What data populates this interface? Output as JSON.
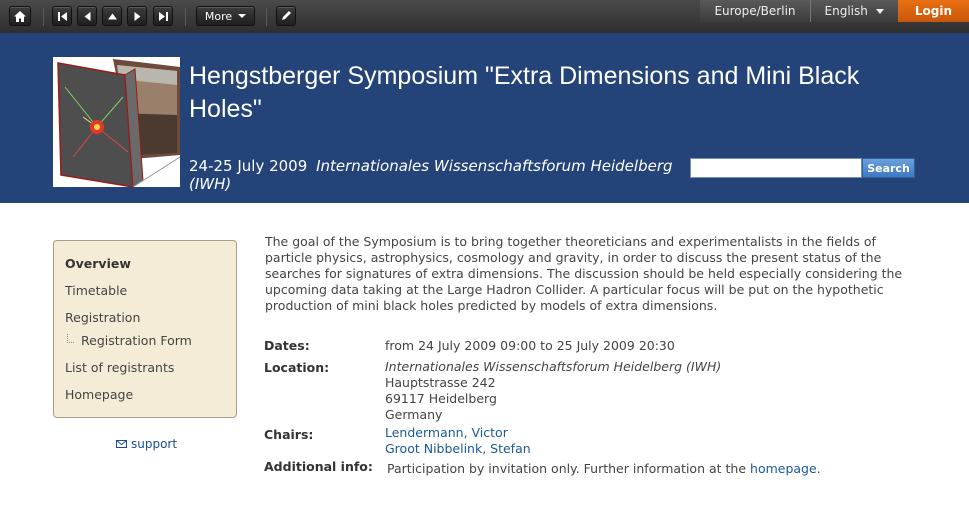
{
  "toolbar": {
    "more_label": "More",
    "icons": [
      "home-icon",
      "first-icon",
      "previous-icon",
      "up-icon",
      "next-icon",
      "last-icon",
      "edit-icon"
    ]
  },
  "topright": {
    "timezone": "Europe/Berlin",
    "language": "English",
    "login": "Login"
  },
  "header": {
    "title": "Hengstberger Symposium \"Extra Dimensions and Mini Black Holes\"",
    "dates": "24-25 July 2009",
    "venue": "Internationales Wissenschaftsforum Heidelberg (IWH)",
    "search_button": "Search",
    "search_value": ""
  },
  "sidebar": {
    "items": [
      {
        "label": "Overview"
      },
      {
        "label": "Timetable"
      },
      {
        "label": "Registration"
      },
      {
        "label": "Registration Form"
      },
      {
        "label": "List of registrants"
      },
      {
        "label": "Homepage"
      }
    ],
    "support": "support"
  },
  "main": {
    "description": "The goal of the Symposium is to bring together theoreticians and experimentalists in the fields of particle physics, astrophysics, cosmology and gravity, in order to discuss the present status of the searches for signatures of extra dimensions. The discussion should be held especially considering the upcoming data taking at the Large Hadron Collider. A particular focus will be put on the hypothetic production of mini black holes predicted by models of extra dimensions.",
    "dates_label": "Dates:",
    "dates_value": "from 24 July 2009 09:00 to 25 July 2009 20:30",
    "location_label": "Location:",
    "location_lines": [
      "Internationales Wissenschaftsforum Heidelberg (IWH)",
      "Hauptstrasse 242",
      "69117 Heidelberg",
      "Germany"
    ],
    "chairs_label": "Chairs:",
    "chairs": [
      "Lendermann, Victor",
      "Groot Nibbelink, Stefan"
    ],
    "additional_label": "Additional info:",
    "additional_text": "Participation by invitation only. Further information at the",
    "additional_link": "homepage",
    "additional_end": "."
  }
}
